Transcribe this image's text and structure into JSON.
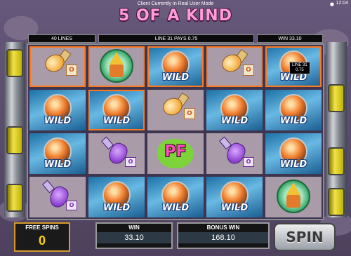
{
  "top": {
    "mode_notice": "Client Currently In Real User Mode",
    "clock": "12:04",
    "headline": "5 OF A KIND"
  },
  "info_bar": {
    "lines": "40 LINES",
    "line_pays": "LINE 31 PAYS 0.75",
    "win": "WIN 33.10"
  },
  "reels": {
    "wild_label": "WILD",
    "bonus_label": "PF",
    "potion_tag": "O",
    "vial_tag": "O",
    "line_badge": {
      "line": "LINE 31",
      "amount": "0.75"
    },
    "grid": [
      [
        "potion",
        "wizard",
        "wild",
        "potion",
        "wild"
      ],
      [
        "wild",
        "wild",
        "potion",
        "wild",
        "wild"
      ],
      [
        "wild",
        "vial",
        "bonus",
        "vial",
        "wild"
      ],
      [
        "vial",
        "wild",
        "wild",
        "wild",
        "wizard"
      ]
    ],
    "highlighted": [
      [
        0,
        0
      ],
      [
        0,
        1
      ],
      [
        0,
        2
      ],
      [
        0,
        3
      ],
      [
        0,
        4
      ],
      [
        1,
        1
      ]
    ]
  },
  "bottom": {
    "free_spins_label": "FREE SPINS",
    "free_spins_value": "0",
    "win_label": "WIN",
    "win_value": "33.10",
    "bonus_win_label": "BONUS WIN",
    "bonus_win_value": "168.10",
    "spin_label": "SPIN"
  },
  "colors": {
    "headline": "#ff9bd6",
    "highlight": "#ff7a1f",
    "free_spins_value": "#ffd400"
  }
}
